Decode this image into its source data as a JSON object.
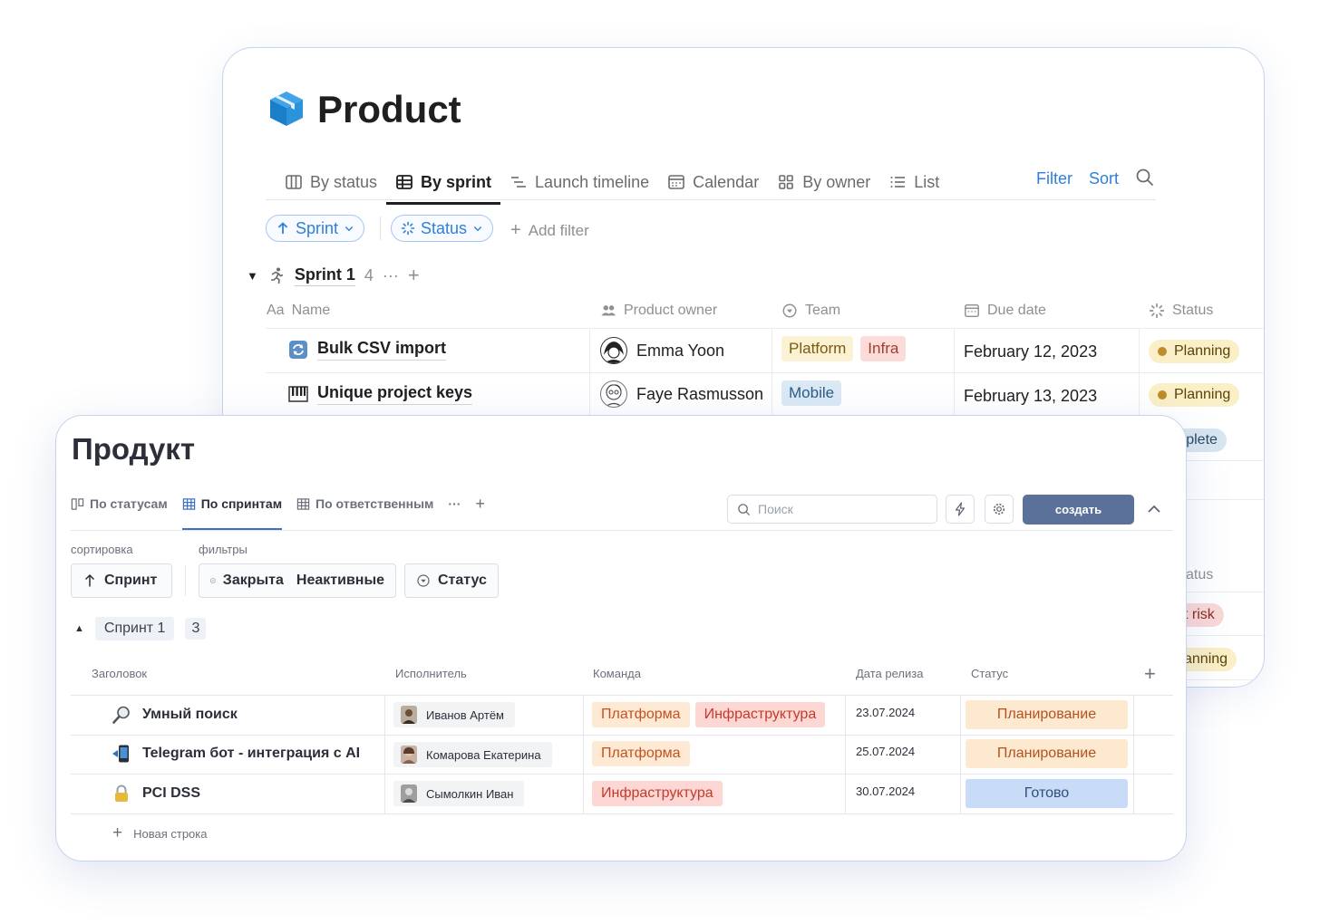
{
  "back": {
    "title": "Product",
    "tabs": [
      {
        "label": "By status",
        "icon": "columns-icon"
      },
      {
        "label": "By sprint",
        "icon": "table-icon"
      },
      {
        "label": "Launch timeline",
        "icon": "timeline-icon"
      },
      {
        "label": "Calendar",
        "icon": "calendar-icon"
      },
      {
        "label": "By owner",
        "icon": "grid-icon"
      },
      {
        "label": "List",
        "icon": "list-icon"
      }
    ],
    "filter_label": "Filter",
    "sort_label": "Sort",
    "pills": [
      {
        "label": "Sprint",
        "icon": "arrow-up-icon"
      },
      {
        "label": "Status",
        "icon": "status-spinner-icon"
      }
    ],
    "add_filter": "Add filter",
    "group": {
      "name": "Sprint 1",
      "count": "4"
    },
    "columns": {
      "name": "Name",
      "name_prefix": "Aa",
      "owner": "Product owner",
      "team": "Team",
      "due": "Due date",
      "status": "Status"
    },
    "rows": [
      {
        "name": "Bulk CSV import",
        "owner": "Emma Yoon",
        "teams": [
          "Platform",
          "Infra"
        ],
        "due": "February 12, 2023",
        "status": "Planning"
      },
      {
        "name": "Unique project keys",
        "owner": "Faye Rasmusson",
        "teams": [
          "Mobile"
        ],
        "due": "February 13, 2023",
        "status": "Planning"
      }
    ],
    "hidden_status_partials": {
      "complete": "omplete",
      "status_header": "atus",
      "risk": "t risk",
      "planning": "anning"
    }
  },
  "front": {
    "title": "Продукт",
    "tabs": [
      "По статусам",
      "По спринтам",
      "По ответственным"
    ],
    "more": "···",
    "add_tab": "+",
    "search_placeholder": "Поиск",
    "create": "создать",
    "sort_label": "сортировка",
    "filters_label": "фильтры",
    "sort_chip": "Спринт",
    "filter_chip_1a": "Закрыта",
    "filter_chip_1b": "Неактивные",
    "filter_chip_2": "Статус",
    "group": {
      "name": "Спринт 1",
      "count": "3"
    },
    "columns": {
      "title": "Заголовок",
      "assignee": "Исполнитель",
      "team": "Команда",
      "release": "Дата релиза",
      "status": "Статус"
    },
    "rows": [
      {
        "title": "Умный поиск",
        "assignee": "Иванов Артём",
        "teams": [
          "Платформа",
          "Инфраструктура"
        ],
        "date": "23.07.2024",
        "status": "Планирование"
      },
      {
        "title": "Telegram бот - интеграция с AI",
        "assignee": "Комарова Екатерина",
        "teams": [
          "Платформа"
        ],
        "date": "25.07.2024",
        "status": "Планирование"
      },
      {
        "title": "PCI DSS",
        "assignee": "Сымолкин Иван",
        "teams": [
          "Инфраструктура"
        ],
        "date": "30.07.2024",
        "status": "Готово"
      }
    ],
    "new_row": "Новая строка"
  },
  "colors": {
    "accent_blue": "#2f7fd9",
    "create_button": "#5b7199",
    "planning_bg": "#fde9d0",
    "done_bg": "#c9dcf7"
  }
}
